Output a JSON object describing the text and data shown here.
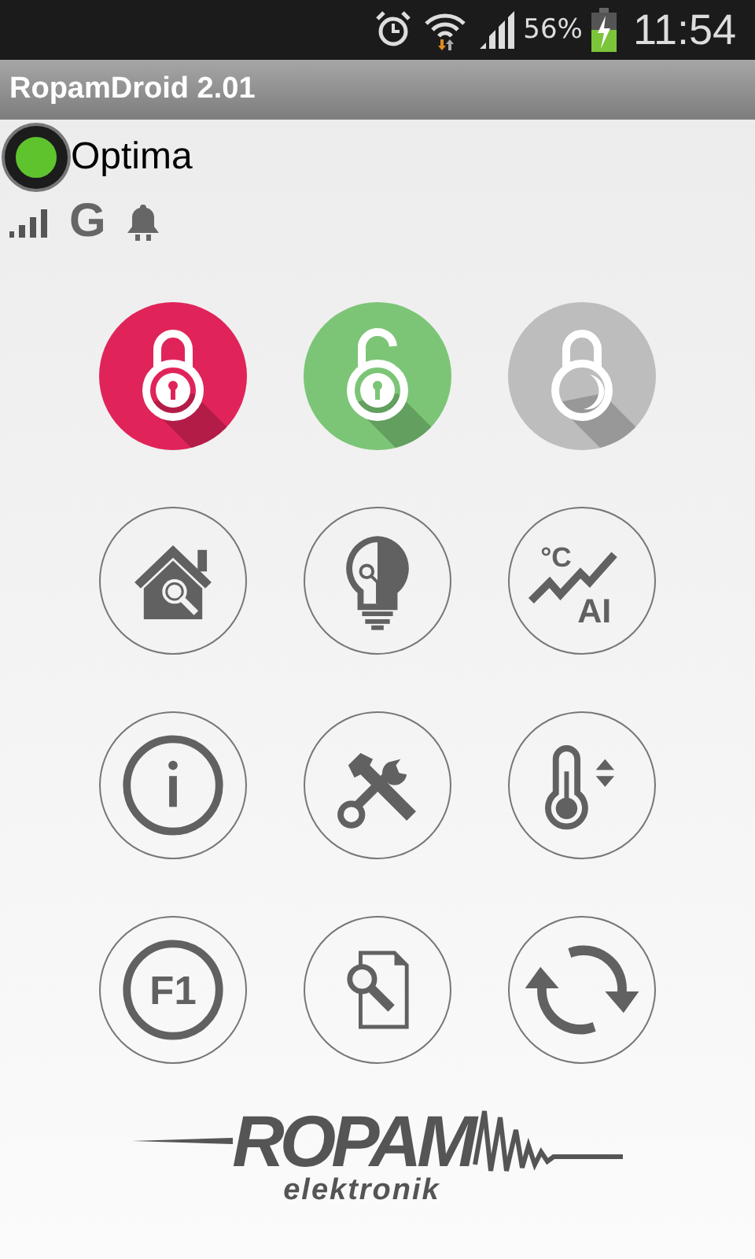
{
  "status_bar": {
    "battery": "56%",
    "time": "11:54"
  },
  "title": "RopamDroid 2.01",
  "panel": {
    "name": "Optima",
    "color": "#5fc32e",
    "network": "G"
  },
  "tiles": [
    {
      "kind": "lock-closed",
      "color": "#e0245a"
    },
    {
      "kind": "lock-open",
      "color": "#7cc576"
    },
    {
      "kind": "lock-off",
      "color": "#bdbdbd"
    },
    {
      "kind": "house-search"
    },
    {
      "kind": "bulb"
    },
    {
      "kind": "chart",
      "labels": [
        "°C",
        "AI"
      ]
    },
    {
      "kind": "info"
    },
    {
      "kind": "tools"
    },
    {
      "kind": "thermo"
    },
    {
      "kind": "fkey",
      "labels": [
        "F1"
      ]
    },
    {
      "kind": "doc-search"
    },
    {
      "kind": "refresh"
    }
  ],
  "logo": {
    "brand": "ROPAM",
    "subtitle": "elektronik"
  }
}
